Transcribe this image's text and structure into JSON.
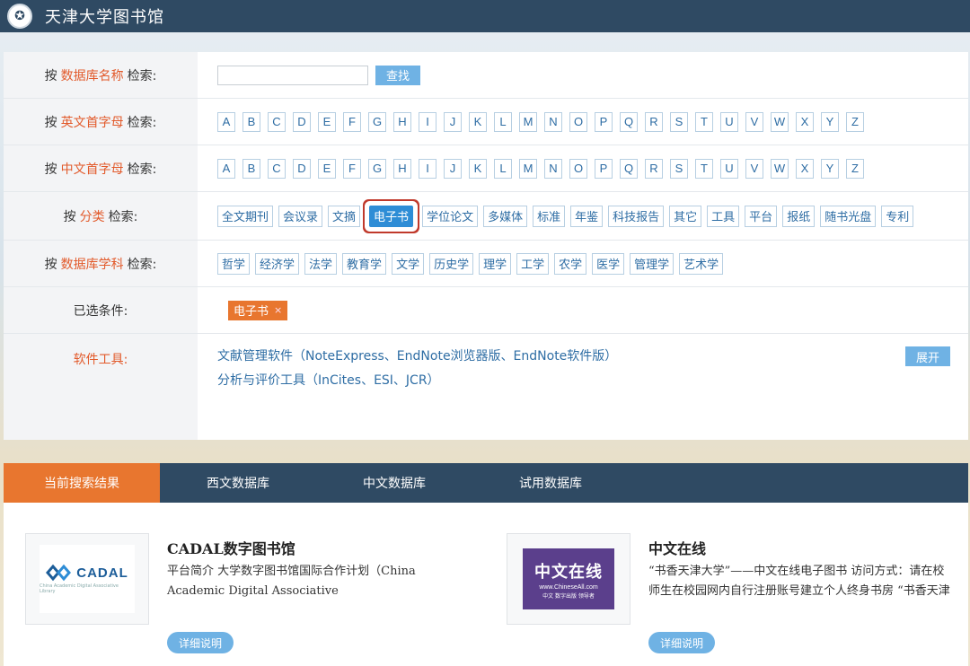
{
  "header": {
    "title": "天津大学图书馆",
    "logo_icon": "seal-icon"
  },
  "search": {
    "db_name": {
      "prefix": "按",
      "highlight": "数据库名称",
      "suffix": "检索:",
      "input_value": "",
      "button": "查找"
    },
    "english_letter": {
      "prefix": "按",
      "highlight": "英文首字母",
      "suffix": "检索:"
    },
    "chinese_letter": {
      "prefix": "按",
      "highlight": "中文首字母",
      "suffix": "检索:"
    },
    "letters": [
      "A",
      "B",
      "C",
      "D",
      "E",
      "F",
      "G",
      "H",
      "I",
      "J",
      "K",
      "L",
      "M",
      "N",
      "O",
      "P",
      "Q",
      "R",
      "S",
      "T",
      "U",
      "V",
      "W",
      "X",
      "Y",
      "Z"
    ],
    "category": {
      "prefix": "按",
      "highlight": "分类",
      "suffix": "检索:",
      "items": [
        "全文期刊",
        "会议录",
        "文摘",
        "电子书",
        "学位论文",
        "多媒体",
        "标准",
        "年鉴",
        "科技报告",
        "其它",
        "工具",
        "平台",
        "报纸",
        "随书光盘",
        "专利"
      ],
      "selected": "电子书"
    },
    "subject": {
      "prefix": "按",
      "highlight": "数据库学科",
      "suffix": "检索:",
      "items": [
        "哲学",
        "经济学",
        "法学",
        "教育学",
        "文学",
        "历史学",
        "理学",
        "工学",
        "农学",
        "医学",
        "管理学",
        "艺术学"
      ]
    },
    "selected_conditions": {
      "label": "已选条件:",
      "chip": "电子书",
      "chip_close": "×"
    },
    "software": {
      "label": "软件工具:",
      "line1": "文献管理软件（NoteExpress、EndNote浏览器版、EndNote软件版）",
      "line2": "分析与评价工具（InCites、ESI、JCR）",
      "expand": "展开"
    }
  },
  "tabs": [
    "当前搜索结果",
    "西文数据库",
    "中文数据库",
    "试用数据库"
  ],
  "active_tab": 0,
  "results": [
    {
      "title": "CADAL数字图书馆",
      "desc": "平台简介 大学数字图书馆国际合作计划（China Academic Digital Associative",
      "button": "详细说明",
      "logo_text": "CADAL",
      "logo_sub": "China Academic Digital Associative Library"
    },
    {
      "title": "中文在线",
      "desc": "“书香天津大学”——中文在线电子图书 访问方式：请在校师生在校园网内自行注册账号建立个人终身书房 “书香天津",
      "button": "详细说明",
      "logo_main": "中文在线",
      "logo_url": "www.ChineseAll.com",
      "logo_small": "中文 数字出版 领导者"
    }
  ]
}
